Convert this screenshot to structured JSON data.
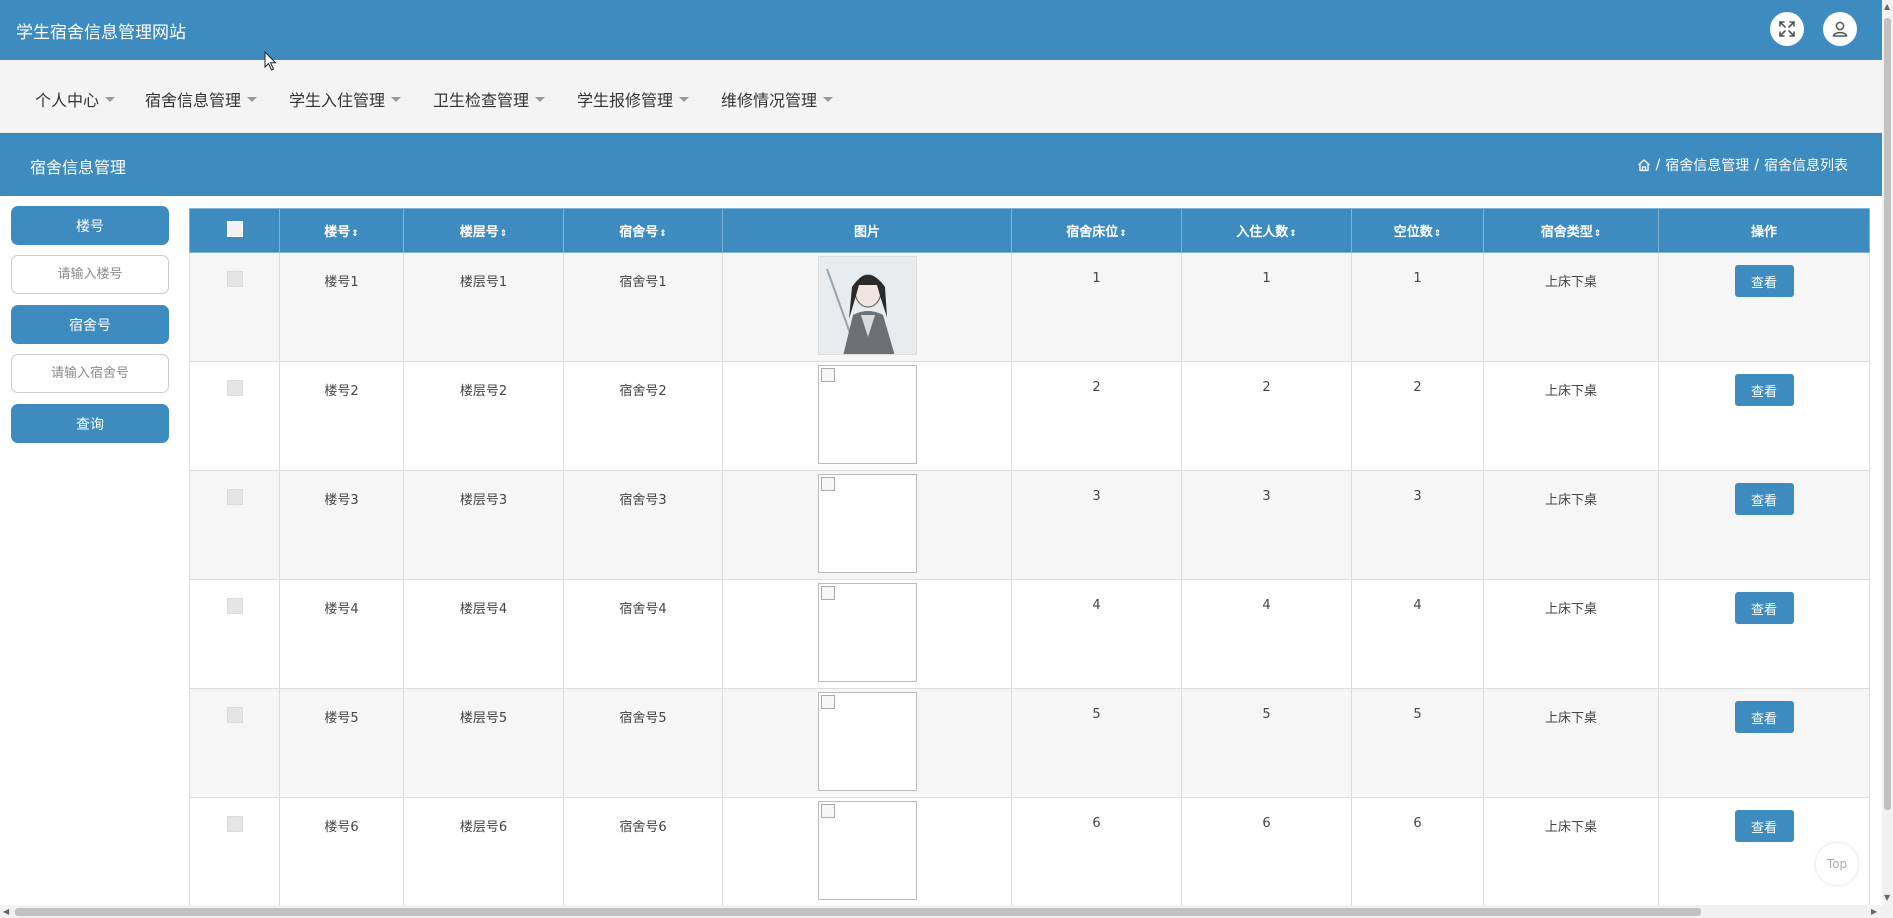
{
  "site_title": "学生宿舍信息管理网站",
  "nav": [
    "个人中心",
    "宿舍信息管理",
    "学生入住管理",
    "卫生检查管理",
    "学生报修管理",
    "维修情况管理"
  ],
  "banner": {
    "title": "宿舍信息管理",
    "crumb_1": "宿舍信息管理",
    "crumb_2": "宿舍信息列表",
    "sep": "/"
  },
  "search": {
    "building_label": "楼号",
    "building_placeholder": "请输入楼号",
    "room_label": "宿舍号",
    "room_placeholder": "请输入宿舍号",
    "query_button": "查询"
  },
  "table": {
    "sort_glyph": "⇕",
    "headers": {
      "building": "楼号",
      "floor": "楼层号",
      "room": "宿舍号",
      "image": "图片",
      "beds": "宿舍床位",
      "occupants": "入住人数",
      "vacant": "空位数",
      "type": "宿舍类型",
      "action": "操作"
    },
    "view_label": "查看",
    "rows": [
      {
        "building": "楼号1",
        "floor": "楼层号1",
        "room": "宿舍号1",
        "beds": "1",
        "occupants": "1",
        "vacant": "1",
        "type": "上床下桌",
        "image_loaded": true
      },
      {
        "building": "楼号2",
        "floor": "楼层号2",
        "room": "宿舍号2",
        "beds": "2",
        "occupants": "2",
        "vacant": "2",
        "type": "上床下桌",
        "image_loaded": false
      },
      {
        "building": "楼号3",
        "floor": "楼层号3",
        "room": "宿舍号3",
        "beds": "3",
        "occupants": "3",
        "vacant": "3",
        "type": "上床下桌",
        "image_loaded": false
      },
      {
        "building": "楼号4",
        "floor": "楼层号4",
        "room": "宿舍号4",
        "beds": "4",
        "occupants": "4",
        "vacant": "4",
        "type": "上床下桌",
        "image_loaded": false
      },
      {
        "building": "楼号5",
        "floor": "楼层号5",
        "room": "宿舍号5",
        "beds": "5",
        "occupants": "5",
        "vacant": "5",
        "type": "上床下桌",
        "image_loaded": false
      },
      {
        "building": "楼号6",
        "floor": "楼层号6",
        "room": "宿舍号6",
        "beds": "6",
        "occupants": "6",
        "vacant": "6",
        "type": "上床下桌",
        "image_loaded": false
      }
    ]
  },
  "top_button": "Top",
  "colors": {
    "primary": "#3d8bbf",
    "nav_bg": "#f4f4f4"
  },
  "icons": [
    "fullscreen-icon",
    "user-icon",
    "home-icon",
    "caret-down-icon",
    "broken-image-icon",
    "mouse-cursor-icon"
  ]
}
